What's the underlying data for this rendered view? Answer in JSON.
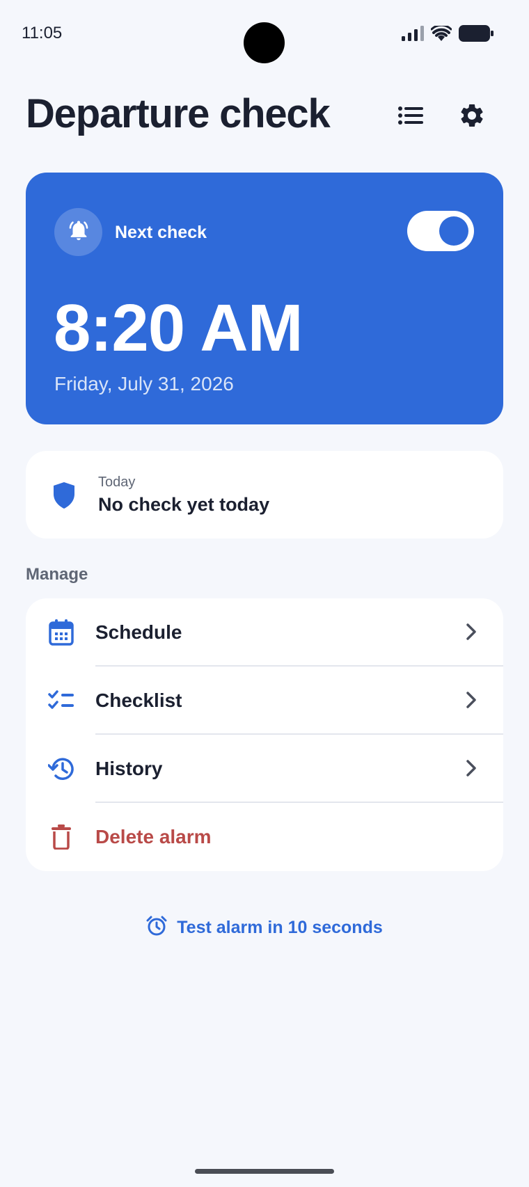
{
  "status_bar": {
    "time": "11:05",
    "icons": [
      "signal-icon",
      "wifi-icon",
      "battery-icon"
    ]
  },
  "header": {
    "title": "Departure check",
    "icons": [
      "list-icon",
      "gear-icon"
    ]
  },
  "next_check": {
    "label": "Next check",
    "time": "8:20 AM",
    "date": "Friday, July 31, 2026",
    "enabled": true,
    "icon": "bell-icon"
  },
  "today": {
    "label": "Today",
    "status": "No check yet today",
    "icon": "shield-icon"
  },
  "manage": {
    "title": "Manage",
    "items": [
      {
        "label": "Schedule",
        "icon": "calendar-icon"
      },
      {
        "label": "Checklist",
        "icon": "checklist-icon"
      },
      {
        "label": "History",
        "icon": "history-icon"
      },
      {
        "label": "Delete alarm",
        "icon": "trash-icon"
      }
    ]
  },
  "test_alarm": {
    "label": "Test alarm in 10 seconds",
    "icon": "alarm-clock-icon"
  },
  "colors": {
    "accent": "#2f6ad9",
    "danger": "#b94a48",
    "background": "#f5f7fc"
  }
}
